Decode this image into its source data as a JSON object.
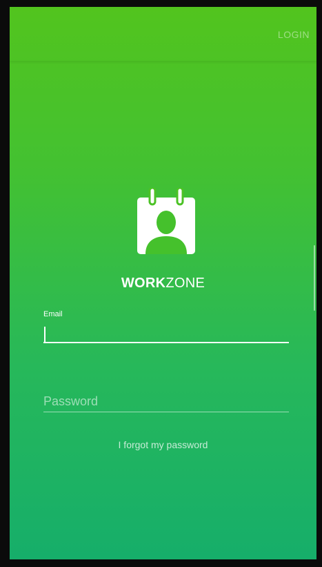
{
  "header": {
    "login_label": "LOGIN"
  },
  "logo": {
    "icon": "calendar-person-icon",
    "brand_bold": "WORK",
    "brand_light": "ZONE"
  },
  "form": {
    "email_label": "Email",
    "email_value": "",
    "password_placeholder": "Password",
    "password_value": "",
    "forgot_label": "I forgot my password"
  },
  "colors": {
    "gradient_top": "#52c41e",
    "gradient_bottom": "#16ae6a",
    "text": "#ffffff"
  }
}
